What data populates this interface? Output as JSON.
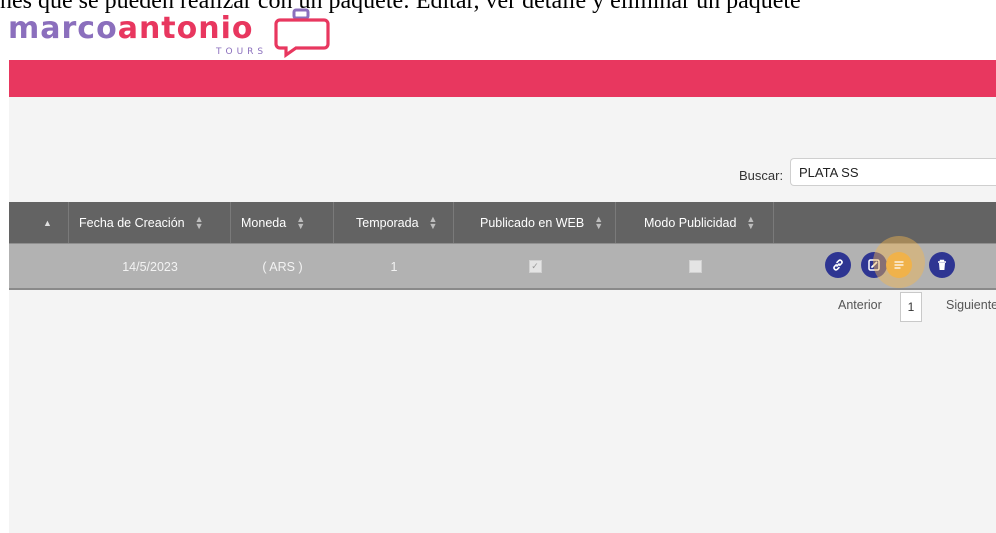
{
  "caption": "nes que se pueden realizar con un paquete: Editar, ver detalle y eliminar un paquete",
  "logo": {
    "part1": "marco",
    "part2": "antonio",
    "sub": "TOURS"
  },
  "search": {
    "label": "Buscar:",
    "value": "PLATA SS"
  },
  "table": {
    "columns": [
      "",
      "Fecha de Creación",
      "Moneda",
      "Temporada",
      "Publicado en WEB",
      "Modo Publicidad",
      ""
    ],
    "rows": [
      {
        "fecha": "14/5/2023",
        "moneda": "( ARS )",
        "temporada": "1",
        "publicado_web": true,
        "modo_publicidad": false,
        "actions": [
          "link-icon",
          "edit-icon",
          "details-icon",
          "trash-icon"
        ]
      }
    ]
  },
  "pagination": {
    "prev": "Anterior",
    "page": "1",
    "next": "Siguiente"
  },
  "colors": {
    "brand_pink": "#e8375f",
    "brand_purple": "#8b6fbd",
    "action_blue": "#2e3592",
    "highlight": "#f0b24a"
  }
}
